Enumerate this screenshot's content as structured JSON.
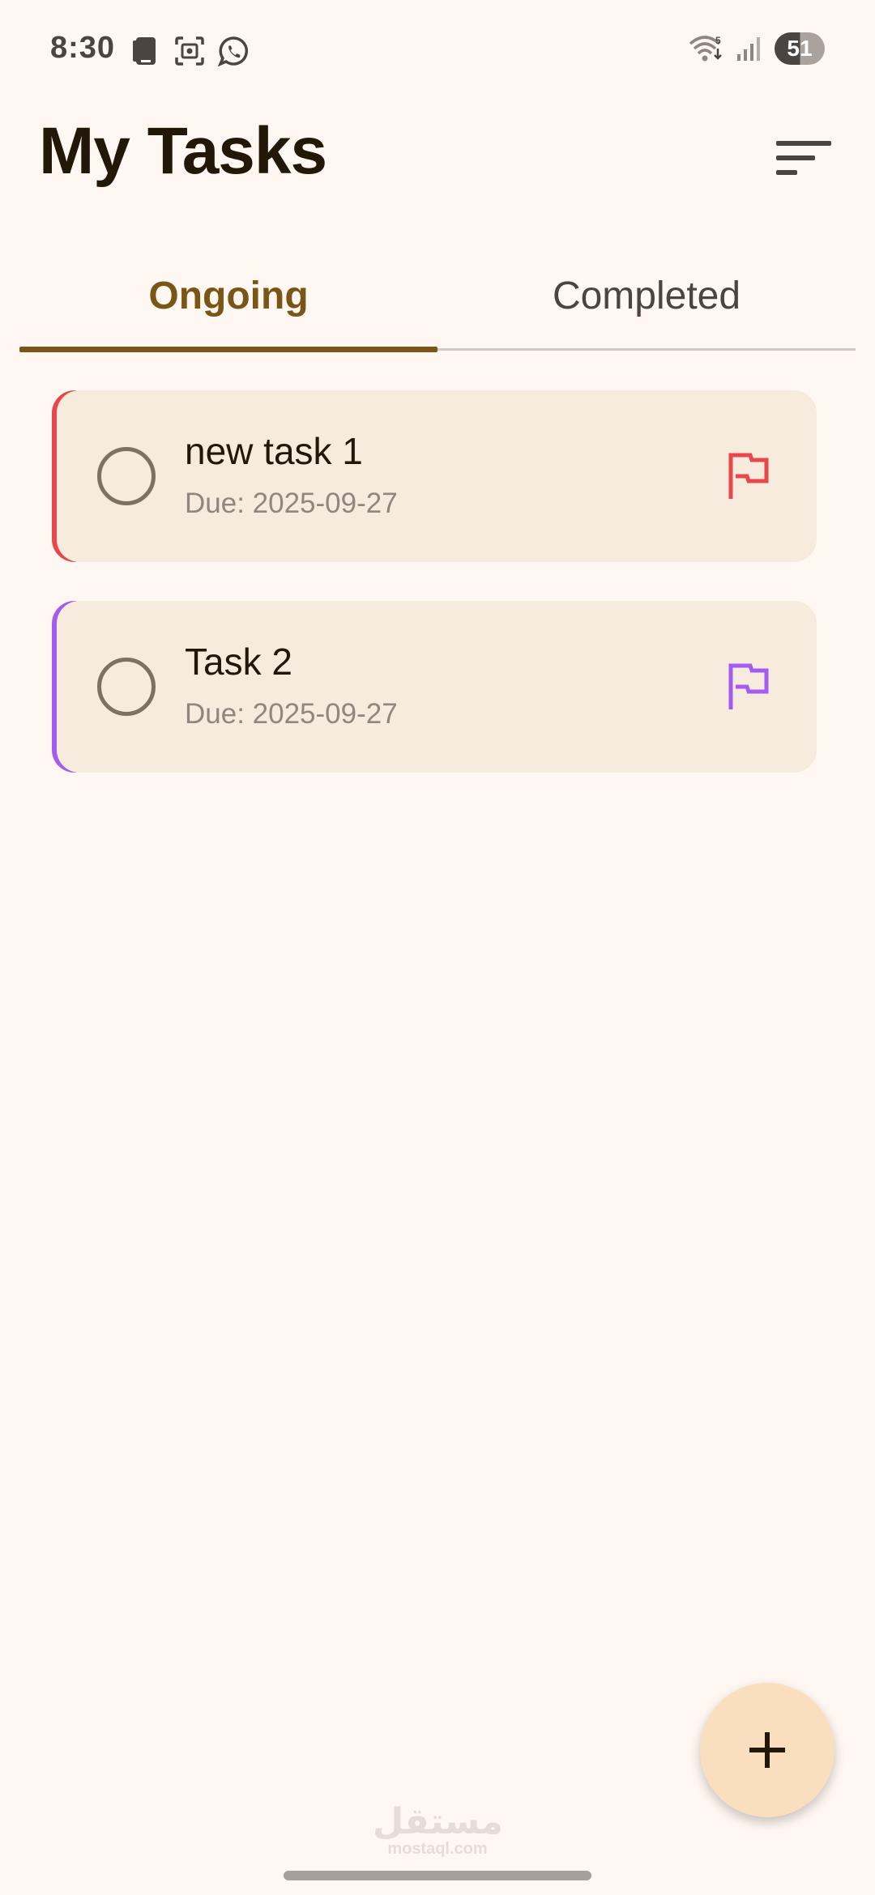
{
  "status_bar": {
    "time": "8:30",
    "battery": "51",
    "left_icons": [
      "device-icon",
      "screenshot-icon",
      "whatsapp-icon"
    ],
    "right_icons": [
      "wifi-icon",
      "signal-icon"
    ],
    "wifi_label": "5"
  },
  "header": {
    "title": "My Tasks",
    "sort_icon": "sort-icon"
  },
  "tabs": [
    {
      "label": "Ongoing",
      "selected": true
    },
    {
      "label": "Completed",
      "selected": false
    }
  ],
  "colors": {
    "accent": "#7a5616",
    "background": "#fff7f1",
    "card": "#f7ebde",
    "fab": "#fadfbf",
    "priority_high": "#e8474c",
    "priority_low": "#a35bf0"
  },
  "tasks": [
    {
      "title": "new task 1",
      "due": "Due: 2025-09-27",
      "priority_color": "#e8474c",
      "completed": false,
      "flag_icon": "flag-icon"
    },
    {
      "title": "Task 2",
      "due": "Due: 2025-09-27",
      "priority_color": "#a35bf0",
      "completed": false,
      "flag_icon": "flag-icon"
    }
  ],
  "fab": {
    "icon": "plus-icon"
  },
  "watermark": {
    "logo": "مستقل",
    "text": "mostaql.com"
  }
}
